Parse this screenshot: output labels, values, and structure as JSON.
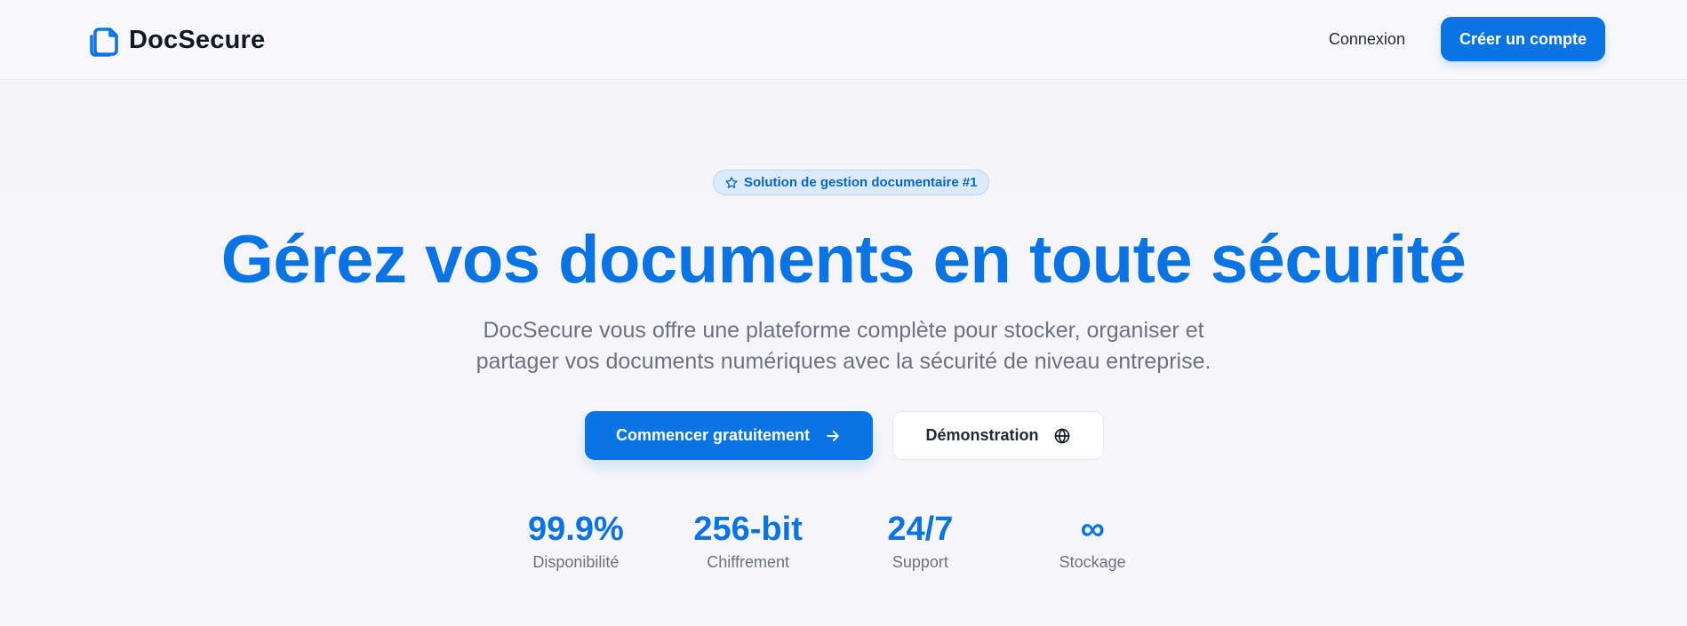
{
  "brand": {
    "name": "DocSecure",
    "icon": "document-stack-icon",
    "accent_color": "#0b74e5"
  },
  "nav": {
    "login": "Connexion",
    "signup": "Créer un compte"
  },
  "hero": {
    "badge": {
      "icon": "star-icon",
      "label": "Solution de gestion documentaire #1"
    },
    "title": "Gérez vos documents en toute sécurité",
    "description": "DocSecure vous offre une plateforme complète pour stocker, organiser et partager vos documents numériques avec la sécurité de niveau entreprise.",
    "buttons": {
      "primary": {
        "label": "Commencer gratuitement",
        "icon": "arrow-right-icon"
      },
      "secondary": {
        "label": "Démonstration",
        "icon": "globe-icon"
      }
    }
  },
  "stats": [
    {
      "value": "99.9%",
      "label": "Disponibilité"
    },
    {
      "value": "256-bit",
      "label": "Chiffrement"
    },
    {
      "value": "24/7",
      "label": "Support"
    },
    {
      "value": "∞",
      "label": "Stockage"
    }
  ]
}
